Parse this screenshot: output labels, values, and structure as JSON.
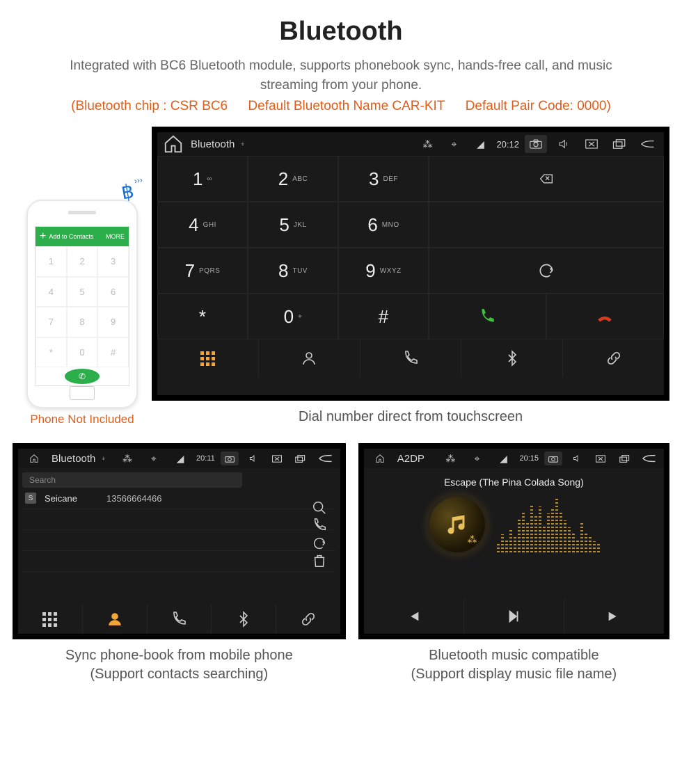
{
  "page": {
    "title": "Bluetooth",
    "desc": "Integrated with BC6 Bluetooth module, supports phonebook sync, hands-free call, and music streaming from your phone.",
    "note_chip": "(Bluetooth chip : CSR BC6",
    "note_name": "Default Bluetooth Name CAR-KIT",
    "note_code": "Default Pair Code: 0000)"
  },
  "phone": {
    "add_label": "Add to Contacts",
    "more_label": "MORE",
    "keys": [
      "1",
      "2",
      "3",
      "4",
      "5",
      "6",
      "7",
      "8",
      "9",
      "*",
      "0",
      "#"
    ],
    "not_included": "Phone Not Included"
  },
  "screen1": {
    "statusbar": {
      "title": "Bluetooth",
      "time": "20:12"
    },
    "keys": [
      {
        "n": "1",
        "s": "∞"
      },
      {
        "n": "2",
        "s": "ABC"
      },
      {
        "n": "3",
        "s": "DEF"
      },
      {
        "n": "4",
        "s": "GHI"
      },
      {
        "n": "5",
        "s": "JKL"
      },
      {
        "n": "6",
        "s": "MNO"
      },
      {
        "n": "7",
        "s": "PQRS"
      },
      {
        "n": "8",
        "s": "TUV"
      },
      {
        "n": "9",
        "s": "WXYZ"
      },
      {
        "n": "*",
        "s": ""
      },
      {
        "n": "0",
        "s": "+"
      },
      {
        "n": "#",
        "s": ""
      }
    ],
    "caption": "Dial number direct from touchscreen"
  },
  "screen2": {
    "statusbar": {
      "title": "Bluetooth",
      "time": "20:11"
    },
    "search_placeholder": "Search",
    "contact": {
      "badge": "S",
      "name": "Seicane",
      "number": "13566664466"
    },
    "caption1": "Sync phone-book from mobile phone",
    "caption2": "(Support contacts searching)"
  },
  "screen3": {
    "statusbar": {
      "title": "A2DP",
      "time": "20:15"
    },
    "song": "Escape (The Pina Colada Song)",
    "eq_heights": [
      14,
      26,
      18,
      34,
      22,
      48,
      60,
      44,
      70,
      52,
      66,
      40,
      56,
      64,
      78,
      58,
      46,
      36,
      28,
      20,
      42,
      30,
      22,
      16,
      12
    ],
    "caption1": "Bluetooth music compatible",
    "caption2": "(Support display music file name)"
  }
}
